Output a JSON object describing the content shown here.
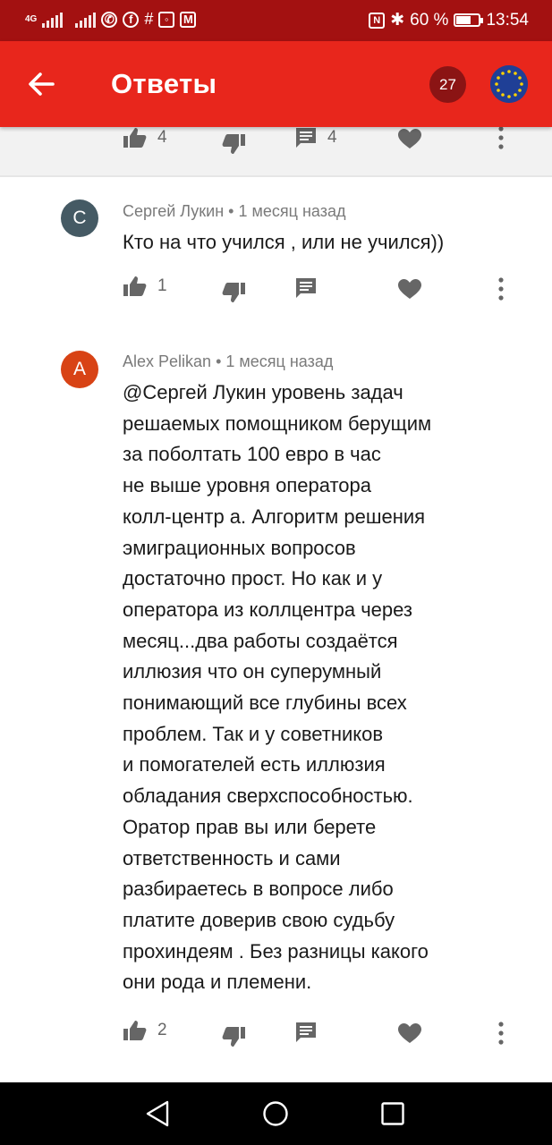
{
  "status_bar": {
    "network": "4G",
    "battery": "60 %",
    "time": "13:54"
  },
  "app_bar": {
    "title": "Ответы",
    "notification_count": "27",
    "avatar_icon": "eu-flag-avatar",
    "brand_color": "#e8261c"
  },
  "top_actions": {
    "likes": "4",
    "replies": "4"
  },
  "comments": [
    {
      "avatar_letter": "С",
      "avatar_color": "#455a64",
      "author": "Сергей Лукин",
      "time": "1 месяц назад",
      "text": "Кто на что учился , или не учился))",
      "likes": "1"
    },
    {
      "avatar_letter": "A",
      "avatar_color": "#d84315",
      "author": "Alex Pelikan",
      "time": "1 месяц назад",
      "text": "@Сергей Лукин уровень задач\nрешаемых помощником берущим\nза поболтать 100 евро в час\nне выше уровня оператора\nколл-центр а. Алгоритм решения\nэмиграционных вопросов\nдостаточно прост. Но как и у\nоператора из коллцентра через\nмесяц...два работы создаётся\nиллюзия что он суперумный\nпонимающий все глубины всех\nпроблем. Так и у советников\nи помогателей есть иллюзия\nобладания сверхспособностью.\nОратор прав вы или берете\nответственность и сами\nразбираетесь в вопросе либо\nплатите доверив свою судьбу\nпрохиндеям . Без разницы какого\nони рода и племени.",
      "likes": "2"
    }
  ]
}
